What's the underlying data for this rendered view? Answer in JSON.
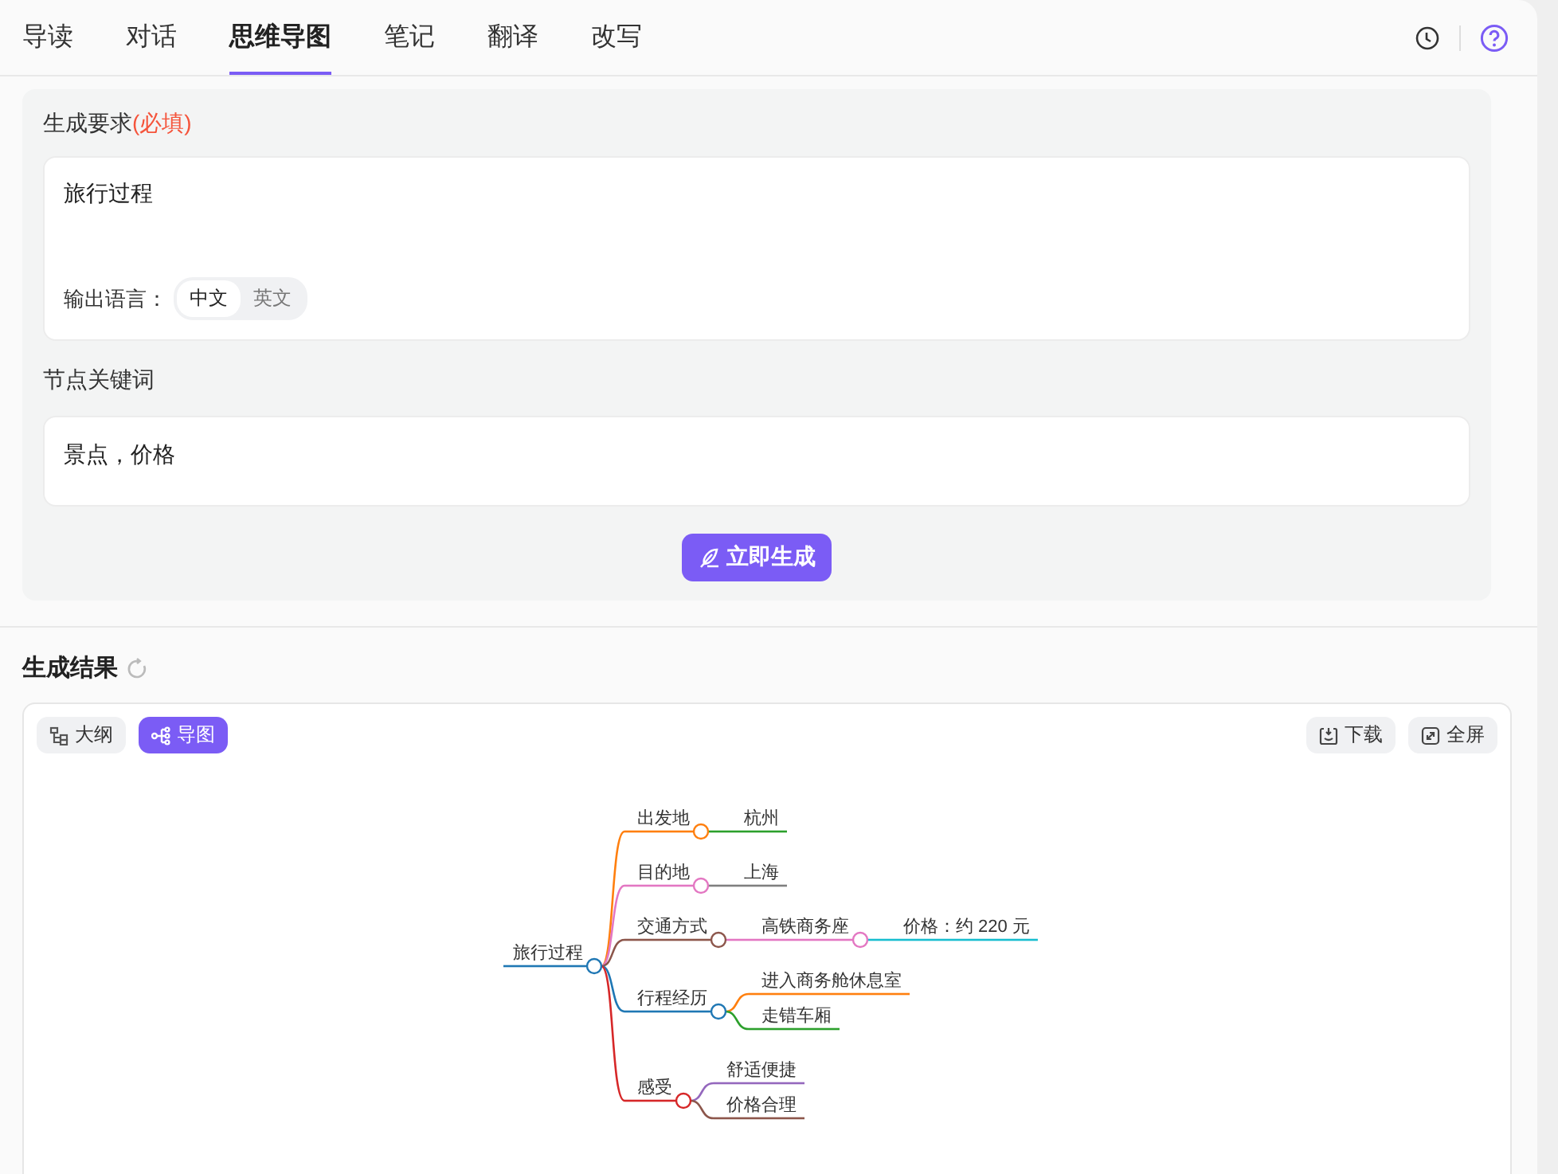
{
  "tabs": [
    {
      "label": "导读",
      "selected": false
    },
    {
      "label": "对话",
      "selected": false
    },
    {
      "label": "思维导图",
      "selected": true
    },
    {
      "label": "笔记",
      "selected": false
    },
    {
      "label": "翻译",
      "selected": false
    },
    {
      "label": "改写",
      "selected": false
    }
  ],
  "form": {
    "requirement_label": "生成要求",
    "required_mark": "(必填)",
    "requirement_value": "旅行过程",
    "language_label": "输出语言：",
    "languages": [
      {
        "label": "中文",
        "selected": true
      },
      {
        "label": "英文",
        "selected": false
      }
    ],
    "keywords_label": "节点关键词",
    "keywords_value": "景点，价格",
    "generate_button": "立即生成"
  },
  "result": {
    "title": "生成结果",
    "views": [
      {
        "kind": "outline",
        "label": "大纲",
        "selected": false
      },
      {
        "kind": "map",
        "label": "导图",
        "selected": true
      }
    ],
    "actions": [
      {
        "kind": "download",
        "label": "下载"
      },
      {
        "kind": "fullscreen",
        "label": "全屏"
      }
    ],
    "mindmap": {
      "text": "旅行过程",
      "color": "#1f77b4",
      "children": [
        {
          "text": "出发地",
          "color": "#ff7f0e",
          "children": [
            {
              "text": "杭州",
              "color": "#2ca02c"
            }
          ]
        },
        {
          "text": "目的地",
          "color": "#e377c2",
          "children": [
            {
              "text": "上海",
              "color": "#7f7f7f"
            }
          ]
        },
        {
          "text": "交通方式",
          "color": "#8c564b",
          "children": [
            {
              "text": "高铁商务座",
              "color": "#e377c2",
              "children": [
                {
                  "text": "价格：约 220 元",
                  "color": "#17becf"
                }
              ]
            }
          ]
        },
        {
          "text": "行程经历",
          "color": "#1f77b4",
          "children": [
            {
              "text": "进入商务舱休息室",
              "color": "#ff7f0e"
            },
            {
              "text": "走错车厢",
              "color": "#2ca02c"
            }
          ]
        },
        {
          "text": "感受",
          "color": "#d62728",
          "children": [
            {
              "text": "舒适便捷",
              "color": "#9467bd"
            },
            {
              "text": "价格合理",
              "color": "#8c564b"
            }
          ]
        }
      ]
    }
  }
}
